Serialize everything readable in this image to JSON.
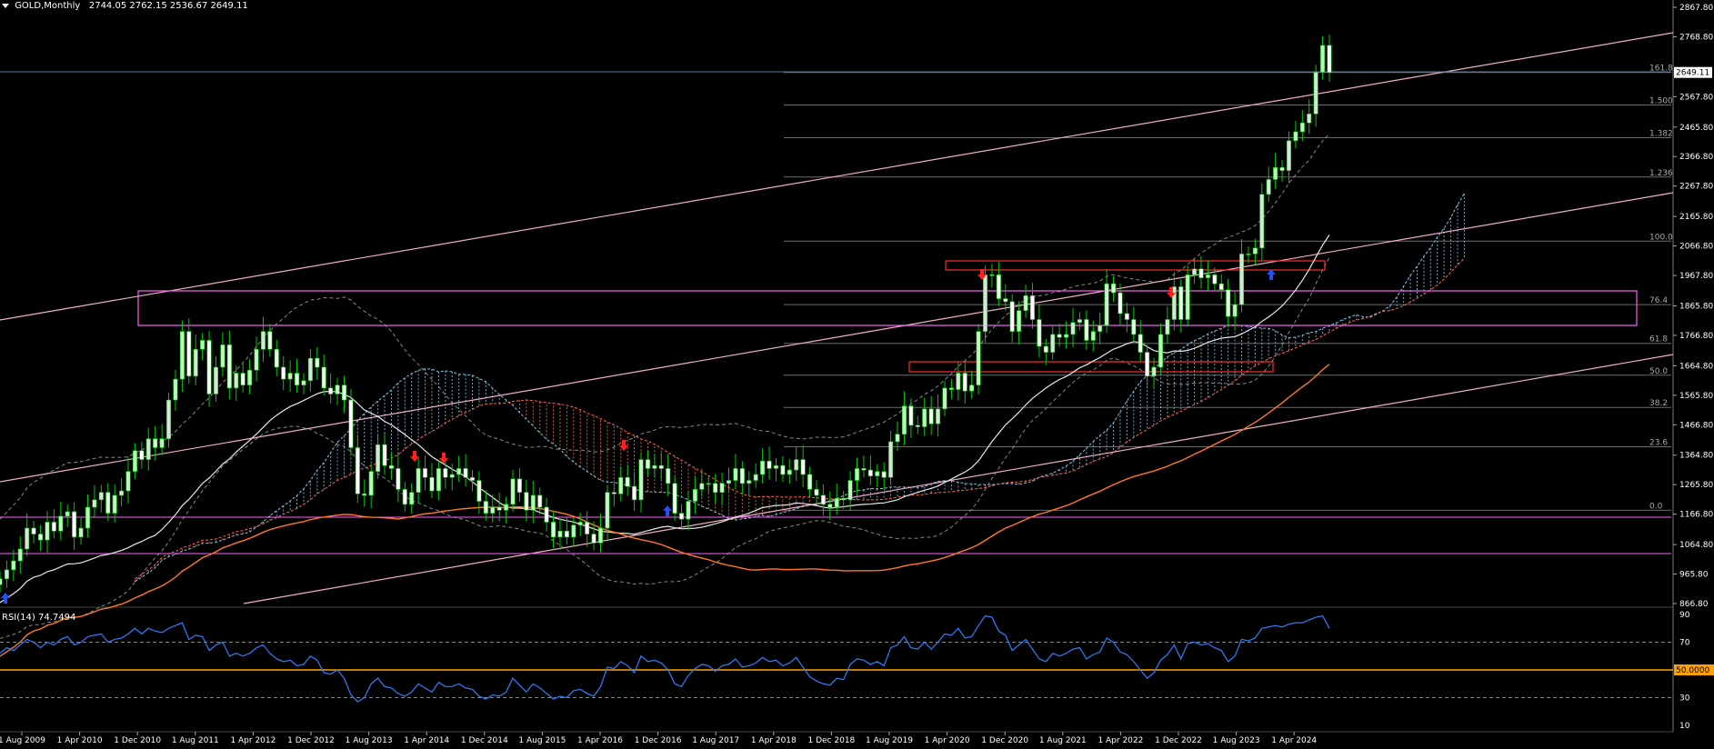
{
  "header": {
    "symbol": "GOLD,Monthly",
    "ohlc": "2744.05 2762.15 2536.67 2649.11"
  },
  "rsi_pane": {
    "title": "RSI(14) 74.7494"
  },
  "colors": {
    "background": "#000000",
    "bull_candle": "#c8f0c8",
    "bear_candle": "#ffffff",
    "wick": "#00cc00",
    "ichimoku_bull": "#7ec8e3",
    "ichimoku_bear": "#ff6a50",
    "zone_box": "#ff60ff",
    "red_box": "#ff3030",
    "channel": "#f0b0c8",
    "ma_slow": "#ff7a20",
    "ma_mid": "#e8e8e8",
    "fib": "#9a9a9a",
    "rsi_line": "#2f7fff",
    "rsi_50": "#ffa000",
    "arrow_up": "#2050ff",
    "arrow_down": "#ff2020"
  },
  "chart_data": [
    {
      "type": "candlestick",
      "title": "GOLD,Monthly",
      "x_axis_labels": [
        "1 Aug 2009",
        "1 Apr 2010",
        "1 Dec 2010",
        "1 Aug 2011",
        "1 Apr 2012",
        "1 Dec 2012",
        "1 Aug 2013",
        "1 Apr 2014",
        "1 Dec 2014",
        "1 Aug 2015",
        "1 Apr 2016",
        "1 Dec 2016",
        "1 Aug 2017",
        "1 Apr 2018",
        "1 Dec 2018",
        "1 Aug 2019",
        "1 Apr 2020",
        "1 Dec 2020",
        "1 Aug 2021",
        "1 Apr 2022",
        "1 Dec 2022",
        "1 Aug 2023",
        "1 Apr 2024"
      ],
      "y_ticks": [
        "2867.80",
        "2768.80",
        "2567.80",
        "2465.80",
        "2366.80",
        "2267.80",
        "2165.80",
        "2066.80",
        "1967.80",
        "1865.80",
        "1766.80",
        "1664.80",
        "1565.80",
        "1466.80",
        "1364.80",
        "1265.80",
        "1166.80",
        "1064.80",
        "965.80",
        "866.80"
      ],
      "ylim": [
        866.8,
        2867.8
      ],
      "current_price_label": "2649.11",
      "fib_levels": [
        {
          "label": "161.8",
          "value": 2649
        },
        {
          "label": "1.500",
          "value": 2540
        },
        {
          "label": "1.382",
          "value": 2430
        },
        {
          "label": "1.236",
          "value": 2298
        },
        {
          "label": "100.0",
          "value": 2083
        },
        {
          "label": "76.4",
          "value": 1870
        },
        {
          "label": "61.8",
          "value": 1740
        },
        {
          "label": "50.0",
          "value": 1633
        },
        {
          "label": "38.2",
          "value": 1525
        },
        {
          "label": "23.6",
          "value": 1393
        },
        {
          "label": "0.0",
          "value": 1180
        }
      ],
      "monthly_closes": [
        950,
        980,
        1010,
        1050,
        1120,
        1100,
        1080,
        1140,
        1110,
        1160,
        1175,
        1090,
        1120,
        1190,
        1215,
        1240,
        1170,
        1230,
        1245,
        1310,
        1380,
        1350,
        1420,
        1390,
        1420,
        1550,
        1620,
        1780,
        1630,
        1720,
        1750,
        1570,
        1660,
        1735,
        1590,
        1640,
        1600,
        1650,
        1720,
        1780,
        1720,
        1660,
        1620,
        1640,
        1600,
        1615,
        1690,
        1660,
        1590,
        1570,
        1600,
        1550,
        1390,
        1235,
        1230,
        1310,
        1400,
        1330,
        1320,
        1250,
        1200,
        1240,
        1320,
        1290,
        1245,
        1320,
        1290,
        1300,
        1320,
        1290,
        1280,
        1210,
        1170,
        1190,
        1180,
        1200,
        1285,
        1240,
        1180,
        1230,
        1190,
        1140,
        1090,
        1110,
        1090,
        1130,
        1140,
        1100,
        1070,
        1120,
        1240,
        1235,
        1290,
        1260,
        1215,
        1350,
        1320,
        1330,
        1320,
        1270,
        1170,
        1150,
        1210,
        1250,
        1270,
        1270,
        1240,
        1270,
        1280,
        1320,
        1270,
        1280,
        1300,
        1345,
        1320,
        1330,
        1300,
        1315,
        1350,
        1300,
        1250,
        1230,
        1200,
        1190,
        1220,
        1215,
        1280,
        1320,
        1315,
        1295,
        1310,
        1290,
        1410,
        1435,
        1530,
        1465,
        1460,
        1520,
        1470,
        1520,
        1590,
        1585,
        1640,
        1580,
        1600,
        1780,
        1970,
        1970,
        1890,
        1880,
        1780,
        1850,
        1900,
        1820,
        1730,
        1710,
        1770,
        1760,
        1770,
        1810,
        1820,
        1750,
        1780,
        1800,
        1940,
        1910,
        1840,
        1820,
        1770,
        1710,
        1630,
        1660,
        1770,
        1820,
        1930,
        1820,
        1970,
        1990,
        1960,
        1970,
        1940,
        1920,
        1830,
        1870,
        2040,
        2040,
        2060,
        2240,
        2290,
        2330,
        2320,
        2420,
        2450,
        2480,
        2510,
        2650,
        2740,
        2649
      ]
    },
    {
      "type": "line",
      "title": "RSI(14) 74.7494",
      "y_ticks": [
        "90",
        "70",
        "50",
        "30",
        "10"
      ],
      "ylim": [
        10,
        90
      ],
      "levels": [
        70,
        50,
        30
      ],
      "level_50_label": "50.0000",
      "values": [
        62,
        66,
        64,
        68,
        72,
        70,
        66,
        70,
        68,
        72,
        74,
        68,
        70,
        74,
        75,
        76,
        70,
        72,
        73,
        76,
        80,
        76,
        80,
        78,
        77,
        80,
        82,
        84,
        72,
        75,
        74,
        64,
        68,
        70,
        60,
        62,
        60,
        62,
        66,
        68,
        62,
        58,
        56,
        57,
        53,
        54,
        60,
        57,
        48,
        47,
        50,
        44,
        32,
        27,
        30,
        40,
        44,
        38,
        37,
        33,
        31,
        34,
        40,
        37,
        34,
        41,
        38,
        38,
        40,
        37,
        36,
        31,
        29,
        32,
        31,
        34,
        44,
        39,
        34,
        40,
        37,
        33,
        29,
        31,
        30,
        35,
        36,
        33,
        31,
        38,
        52,
        51,
        56,
        53,
        48,
        60,
        56,
        57,
        55,
        50,
        40,
        38,
        46,
        51,
        54,
        53,
        49,
        53,
        54,
        58,
        52,
        53,
        55,
        59,
        56,
        57,
        53,
        55,
        59,
        52,
        45,
        42,
        40,
        39,
        44,
        43,
        54,
        58,
        57,
        54,
        56,
        53,
        66,
        68,
        74,
        66,
        65,
        70,
        65,
        70,
        76,
        75,
        80,
        73,
        74,
        82,
        89,
        88,
        78,
        75,
        64,
        68,
        72,
        65,
        58,
        56,
        62,
        60,
        62,
        65,
        66,
        58,
        61,
        63,
        73,
        70,
        63,
        61,
        56,
        50,
        44,
        48,
        57,
        61,
        68,
        58,
        69,
        70,
        68,
        69,
        66,
        64,
        56,
        60,
        72,
        71,
        73,
        80,
        81,
        82,
        81,
        83,
        84,
        84,
        86,
        88,
        89,
        80
      ]
    }
  ]
}
